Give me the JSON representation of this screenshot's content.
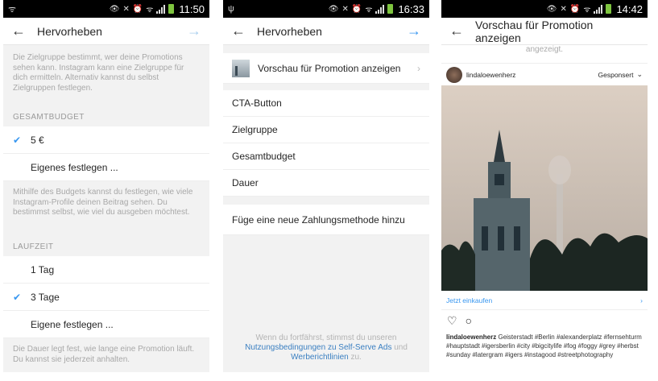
{
  "status_bars": [
    {
      "time": "11:50"
    },
    {
      "time": "16:33"
    },
    {
      "time": "14:42"
    }
  ],
  "screen1": {
    "title": "Hervorheben",
    "hint_audience": "Die Zielgruppe bestimmt, wer deine Promotions sehen kann. Instagram kann eine Zielgruppe für dich ermitteln. Alternativ kannst du selbst Zielgruppen festlegen.",
    "budget_label": "GESAMTBUDGET",
    "budget_options": [
      {
        "label": "5 €",
        "selected": true
      },
      {
        "label": "Eigenes festlegen ...",
        "selected": false
      }
    ],
    "hint_budget": "Mithilfe des Budgets kannst du festlegen, wie viele Instagram-Profile deinen Beitrag sehen. Du bestimmst selbst, wie viel du ausgeben möchtest.",
    "duration_label": "LAUFZEIT",
    "duration_options": [
      {
        "label": "1 Tag",
        "selected": false
      },
      {
        "label": "3 Tage",
        "selected": true
      },
      {
        "label": "Eigene festlegen ...",
        "selected": false
      }
    ],
    "hint_duration": "Die Dauer legt fest, wie lange eine Promotion läuft. Du kannst sie jederzeit anhalten."
  },
  "screen2": {
    "title": "Hervorheben",
    "preview_label": "Vorschau für Promotion anzeigen",
    "items": [
      "CTA-Button",
      "Zielgruppe",
      "Gesamtbudget",
      "Dauer"
    ],
    "payment": "Füge eine neue Zahlungsmethode hinzu",
    "legal_pre": "Wenn du fortfährst, stimmst du unseren",
    "legal_link1": "Nutzungsbedingungen zu Self-Serve Ads",
    "legal_and": "und",
    "legal_link2": "Werberichtlinien",
    "legal_post": "zu."
  },
  "screen3": {
    "title": "Vorschau für Promotion anzeigen",
    "cut_text": "angezeigt.",
    "username": "lindaloewenherz",
    "sponsored": "Gesponsert",
    "shop_now": "Jetzt einkaufen",
    "caption_user": "lindaloewenherz",
    "caption_text": "Geisterstadt #Berlin #alexanderplatz #fernsehturm #hauptstadt #igersberlin #city #bigcitylife #fog #foggy #grey #herbst #sunday #latergram #igers #instagood #streetphotography"
  },
  "colors": {
    "accent": "#3897f0",
    "check": "#3897f0",
    "battery": "#7ec53f"
  }
}
